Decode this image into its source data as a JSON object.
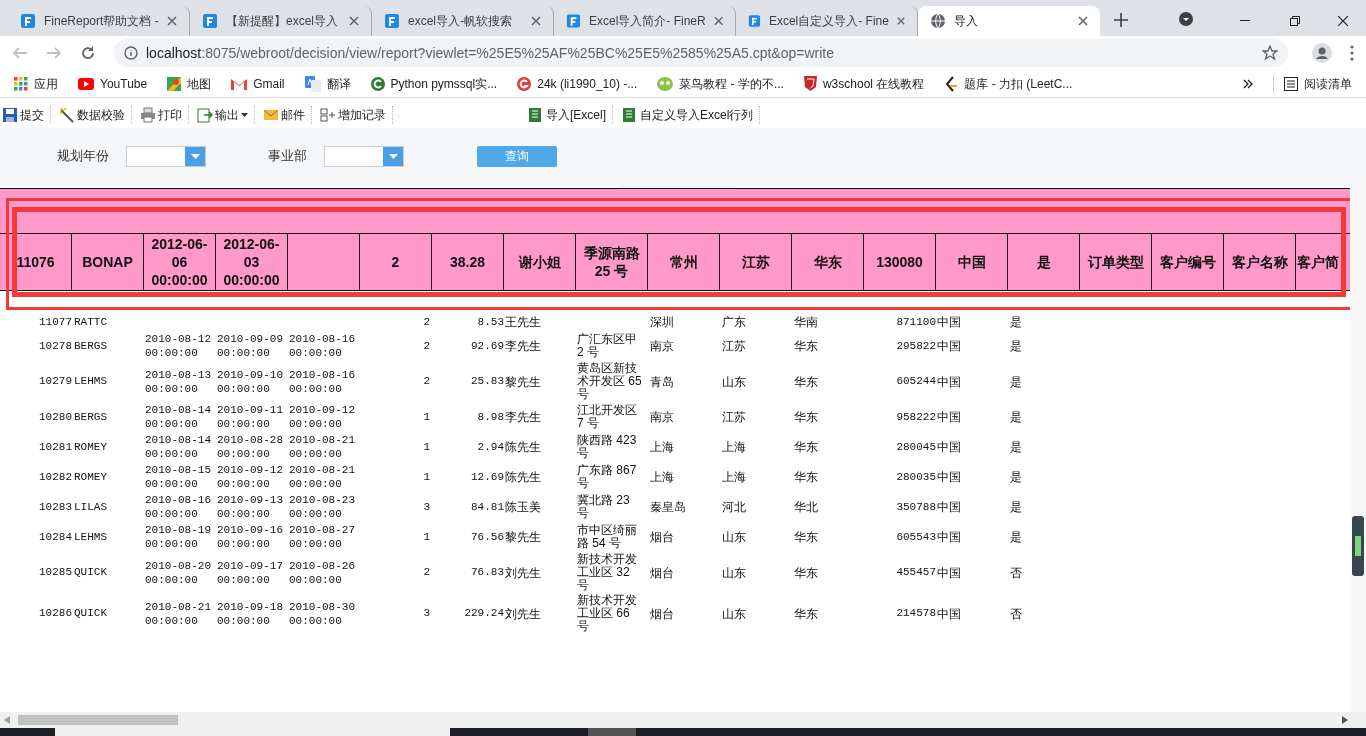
{
  "browser": {
    "tabs": [
      {
        "title": "FineReport帮助文档 -",
        "selected": false
      },
      {
        "title": "【新提醒】excel导入",
        "selected": false
      },
      {
        "title": "excel导入-帆软搜索",
        "selected": false
      },
      {
        "title": "Excel导入简介- FineR",
        "selected": false
      },
      {
        "title": "Excel自定义导入- Fine",
        "selected": false
      },
      {
        "title": "导入",
        "selected": true
      }
    ],
    "url_host": "localhost",
    "url_rest": ":8075/webroot/decision/view/report?viewlet=%25E5%25AF%25BC%25E5%2585%25A5.cpt&op=write",
    "bookmarks": [
      "应用",
      "YouTube",
      "地图",
      "Gmail",
      "翻译",
      "Python pymssql实...",
      "24k (li1990_10) -...",
      "菜鸟教程 - 学的不...",
      "w3school 在线教程",
      "题库 - 力扣 (LeetC..."
    ],
    "reading_list": "阅读清单"
  },
  "report_toolbar": {
    "left": [
      {
        "label": "提交",
        "kind": "plain"
      },
      {
        "label": "数据校验",
        "kind": "plain"
      },
      {
        "label": "打印",
        "kind": "plain"
      },
      {
        "label": "输出",
        "kind": "dropdown"
      },
      {
        "label": "邮件",
        "kind": "plain"
      },
      {
        "label": "增加记录",
        "kind": "plain"
      }
    ],
    "right": [
      "导入[Excel]",
      "自定义导入Excel行列"
    ]
  },
  "filters": [
    {
      "label": "规划年份"
    },
    {
      "label": "事业部"
    }
  ],
  "query_button": "查询",
  "frozen_row": [
    {
      "kind": "text",
      "text": "11076"
    },
    {
      "kind": "text",
      "text": "BONAP"
    },
    {
      "kind": "text",
      "text": "2012-06-06 00:00:00"
    },
    {
      "kind": "text",
      "text": "2012-06-03 00:00:00"
    },
    {
      "kind": "blank"
    },
    {
      "kind": "text",
      "text": "2"
    },
    {
      "kind": "text",
      "text": "38.28"
    },
    {
      "kind": "text",
      "text": "谢小姐"
    },
    {
      "kind": "text",
      "text": "季源南路 25 号"
    },
    {
      "kind": "text",
      "text": "常州"
    },
    {
      "kind": "text",
      "text": "江苏"
    },
    {
      "kind": "text",
      "text": "华东"
    },
    {
      "kind": "text",
      "text": "130080"
    },
    {
      "kind": "text",
      "text": "中国"
    },
    {
      "kind": "text",
      "text": "是"
    },
    {
      "kind": "text",
      "text": "订单类型"
    },
    {
      "kind": "text",
      "text": "客户编号"
    },
    {
      "kind": "text",
      "text": "客户名称"
    },
    {
      "kind": "text",
      "text": "客户简"
    }
  ],
  "rows": [
    {
      "cells": [
        "11077",
        "RATTC",
        null,
        null,
        null,
        "2",
        "8.53",
        "王先生",
        null,
        "深圳",
        "广东",
        "华南",
        "871100",
        "中国",
        "是"
      ]
    },
    {
      "cells": [
        "10278",
        "BERGS",
        "2010-08-12 00:00:00",
        "2010-09-09 00:00:00",
        "2010-08-16 00:00:00",
        "2",
        "92.69",
        "李先生",
        "广汇东区甲 2 号",
        "南京",
        "江苏",
        "华东",
        "295822",
        "中国",
        "是"
      ]
    },
    {
      "cells": [
        "10279",
        "LEHMS",
        "2010-08-13 00:00:00",
        "2010-09-10 00:00:00",
        "2010-08-16 00:00:00",
        "2",
        "25.83",
        "黎先生",
        "黄岛区新技术开发区 65 号",
        "青岛",
        "山东",
        "华东",
        "605244",
        "中国",
        "是"
      ]
    },
    {
      "cells": [
        "10280",
        "BERGS",
        "2010-08-14 00:00:00",
        "2010-09-11 00:00:00",
        "2010-09-12 00:00:00",
        "1",
        "8.98",
        "李先生",
        "江北开发区 7 号",
        "南京",
        "江苏",
        "华东",
        "958222",
        "中国",
        "是"
      ]
    },
    {
      "cells": [
        "10281",
        "ROMEY",
        "2010-08-14 00:00:00",
        "2010-08-28 00:00:00",
        "2010-08-21 00:00:00",
        "1",
        "2.94",
        "陈先生",
        "陕西路 423 号",
        "上海",
        "上海",
        "华东",
        "280045",
        "中国",
        "是"
      ]
    },
    {
      "cells": [
        "10282",
        "ROMEY",
        "2010-08-15 00:00:00",
        "2010-09-12 00:00:00",
        "2010-08-21 00:00:00",
        "1",
        "12.69",
        "陈先生",
        "广东路 867 号",
        "上海",
        "上海",
        "华东",
        "280035",
        "中国",
        "是"
      ]
    },
    {
      "cells": [
        "10283",
        "LILAS",
        "2010-08-16 00:00:00",
        "2010-09-13 00:00:00",
        "2010-08-23 00:00:00",
        "3",
        "84.81",
        "陈玉美",
        "冀北路 23 号",
        "秦皇岛",
        "河北",
        "华北",
        "350788",
        "中国",
        "是"
      ]
    },
    {
      "cells": [
        "10284",
        "LEHMS",
        "2010-08-19 00:00:00",
        "2010-09-16 00:00:00",
        "2010-08-27 00:00:00",
        "1",
        "76.56",
        "黎先生",
        "市中区绮丽路 54 号",
        "烟台",
        "山东",
        "华东",
        "605543",
        "中国",
        "是"
      ]
    },
    {
      "cells": [
        "10285",
        "QUICK",
        "2010-08-20 00:00:00",
        "2010-09-17 00:00:00",
        "2010-08-26 00:00:00",
        "2",
        "76.83",
        "刘先生",
        "新技术开发工业区 32 号",
        "烟台",
        "山东",
        "华东",
        "455457",
        "中国",
        "否"
      ]
    },
    {
      "cells": [
        "10286",
        "QUICK",
        "2010-08-21 00:00:00",
        "2010-09-18 00:00:00",
        "2010-08-30 00:00:00",
        "3",
        "229.24",
        "刘先生",
        "新技术开发工业区 66 号",
        "烟台",
        "山东",
        "华东",
        "214578",
        "中国",
        "否"
      ]
    }
  ]
}
